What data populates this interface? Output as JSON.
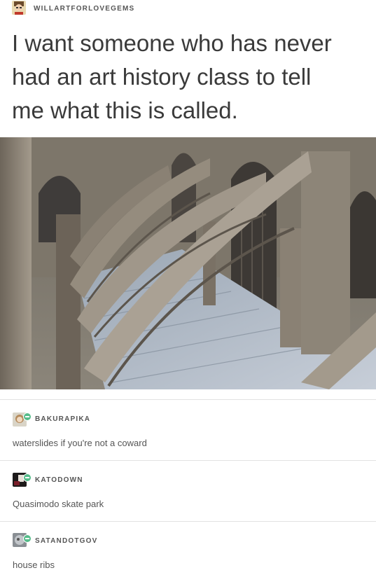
{
  "post": {
    "username": "WILLARTFORLOVEGEMS",
    "text_lines": [
      "I want someone who has never",
      "had an art history class to tell",
      "me what this is called."
    ]
  },
  "replies": [
    {
      "username": "BAKURAPIKA",
      "text": "waterslides if you're not a coward"
    },
    {
      "username": "KATODOWN",
      "text": "Quasimodo skate park"
    },
    {
      "username": "SATANDOTGOV",
      "text": "house ribs"
    }
  ],
  "colors": {
    "badge": "#56bc8a",
    "divider": "#e2e2e2",
    "text": "#3a3a3a"
  }
}
